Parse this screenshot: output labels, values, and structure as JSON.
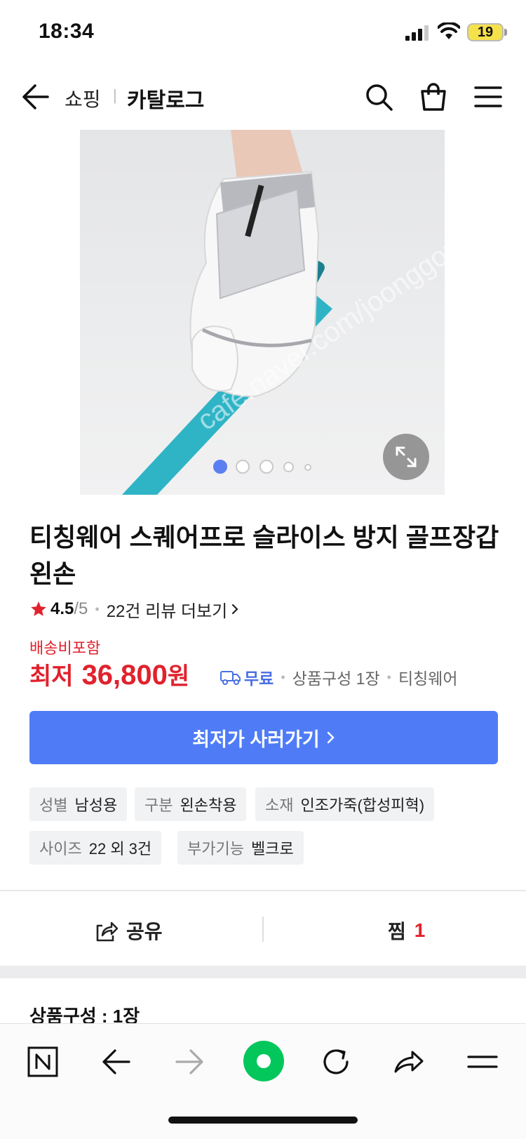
{
  "status_bar": {
    "time": "18:34",
    "battery": "19"
  },
  "header": {
    "breadcrumb_shop": "쇼핑",
    "breadcrumb_separator": "|",
    "breadcrumb_catalog": "카탈로그",
    "icons": [
      "back-arrow-icon",
      "search-icon",
      "shopping-bag-icon",
      "menu-icon"
    ]
  },
  "gallery": {
    "image_count": 5,
    "active_index": 0,
    "image_desc": "white golf glove gripping a teal golf club"
  },
  "product": {
    "title": "티칭웨어 스퀘어프로 슬라이스 방지 골프장갑 왼손",
    "rating": "4.5",
    "rating_max": "/5",
    "review_link": "22건 리뷰 더보기",
    "shipping_included": "배송비포함",
    "price_label": "최저",
    "price_value": "36,800",
    "price_unit": "원",
    "free_shipping": "무료",
    "composition_meta": "상품구성 1장",
    "brand": "티칭웨어",
    "buy_button": "최저가 사러가기"
  },
  "specs": [
    {
      "key": "성별",
      "value": "남성용"
    },
    {
      "key": "구분",
      "value": "왼손착용"
    },
    {
      "key": "소재",
      "value": "인조가죽(합성피혁)"
    },
    {
      "key": "사이즈",
      "value": "22 외 3건"
    },
    {
      "key": "부가기능",
      "value": "벨크로"
    }
  ],
  "actions": {
    "share": "공유",
    "wish": "찜",
    "wish_count": "1"
  },
  "section": {
    "composition_heading": "상품구성 : 1장"
  },
  "colors": {
    "accent_blue": "#4f7cf6",
    "price_red": "#e0222d",
    "free_ship_blue": "#4a6fe3",
    "naver_green": "#03c75a"
  }
}
